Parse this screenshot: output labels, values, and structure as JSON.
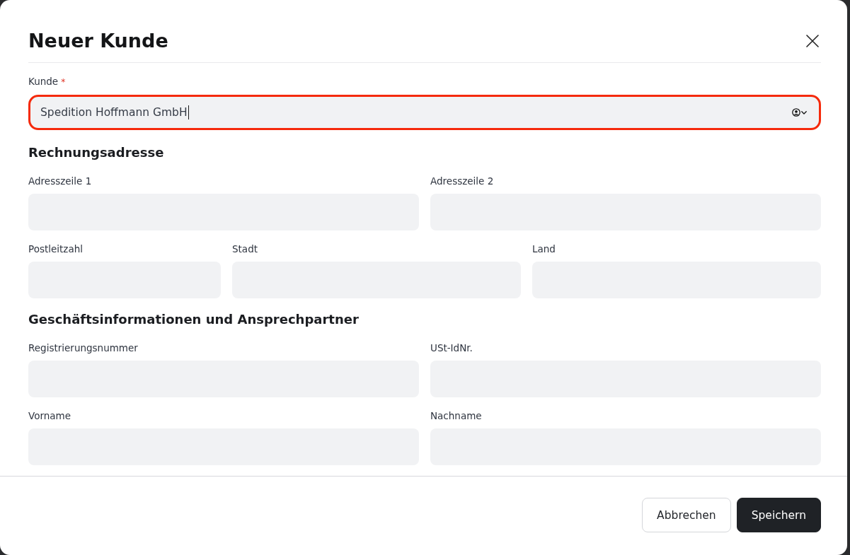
{
  "dialog": {
    "title": "Neuer Kunde"
  },
  "customer": {
    "label": "Kunde",
    "required_mark": "*",
    "value": "Spedition Hoffmann GmbH",
    "focused": true,
    "highlighted": true
  },
  "sections": [
    {
      "title": "Rechnungsadresse",
      "rows": [
        {
          "fields": [
            {
              "label": "Adresszeile 1"
            },
            {
              "label": "Adresszeile 2"
            }
          ]
        },
        {
          "fields": [
            {
              "label": "Postleitzahl"
            },
            {
              "label": "Stadt"
            },
            {
              "label": "Land"
            }
          ]
        }
      ]
    },
    {
      "title": "Geschäftsinformationen und Ansprechpartner",
      "rows": [
        {
          "fields": [
            {
              "label": "Registrierungsnummer"
            },
            {
              "label": "USt-IdNr."
            }
          ]
        },
        {
          "fields": [
            {
              "label": "Vorname"
            },
            {
              "label": "Nachname"
            }
          ]
        }
      ]
    }
  ],
  "buttons": [
    {
      "label": "Abbrechen",
      "kind": "secondary"
    },
    {
      "label": "Speichern",
      "kind": "primary"
    }
  ]
}
